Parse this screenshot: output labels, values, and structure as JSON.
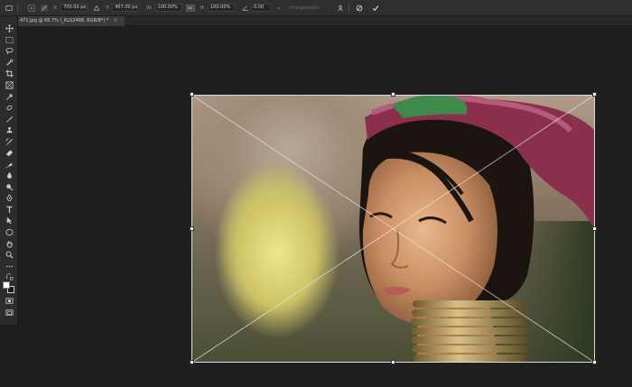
{
  "options_bar": {
    "x_label": "X:",
    "x_value": "700.00 px",
    "y_label": "Y:",
    "y_value": "467.00 px",
    "w_label": "W:",
    "w_value": "100.00%",
    "h_label": "H:",
    "h_value": "100.00%",
    "angle_value": "0.00",
    "link_label": "ax",
    "interp_label": "Interpolation:"
  },
  "document_tab": {
    "title": "471.jpg @ 66.7% (_KLS2468, RGB/8*) *",
    "close_glyph": "×"
  },
  "tools": [
    "move-tool",
    "marquee-tool",
    "lasso-tool",
    "quick-selection-tool",
    "crop-tool",
    "frame-tool",
    "eyedropper-tool",
    "healing-brush-tool",
    "brush-tool",
    "clone-stamp-tool",
    "history-brush-tool",
    "eraser-tool",
    "gradient-tool",
    "blur-tool",
    "dodge-tool",
    "pen-tool",
    "type-tool",
    "path-selection-tool",
    "ellipse-tool",
    "hand-tool",
    "zoom-tool",
    "edit-toolbar",
    "swap-colors",
    "foreground-background-colors",
    "quick-mask-mode",
    "screen-mode"
  ],
  "colors": {
    "foreground": "#ffffff",
    "background": "#1a1a1a",
    "ui_dark": "#2f2f2f",
    "canvas": "#1f1f1f"
  }
}
